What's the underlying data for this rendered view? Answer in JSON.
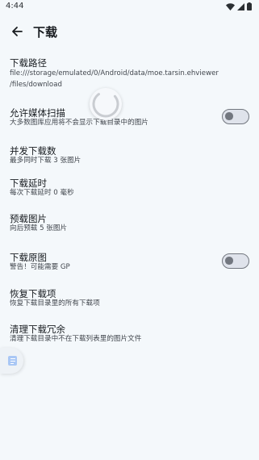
{
  "status_bar": {
    "time": "4:44"
  },
  "app_bar": {
    "title": "下载"
  },
  "prefs": {
    "download_path": {
      "title": "下载路径",
      "summary_line1": "file:///storage/emulated/0/Android/data/moe.tarsin.ehviewer",
      "summary_line2": "/files/download"
    },
    "media_scan": {
      "title": "允许媒体扫描",
      "summary": "大多数图库应用将不会显示下载目录中的图片",
      "enabled": false
    },
    "concurrency": {
      "title": "并发下载数",
      "summary": "最多同时下载 3 张图片"
    },
    "delay": {
      "title": "下载延时",
      "summary": "每次下载延时 0 毫秒"
    },
    "preload": {
      "title": "预载图片",
      "summary": "向后预载 5 张图片"
    },
    "original": {
      "title": "下载原图",
      "summary": "警告！可能需要 GP",
      "enabled": false
    },
    "restore": {
      "title": "恢复下载项",
      "summary": "恢复下载目录里的所有下载项"
    },
    "clean": {
      "title": "清理下载冗余",
      "summary": "清理下载目录中不在下载列表里的图片文件"
    }
  }
}
